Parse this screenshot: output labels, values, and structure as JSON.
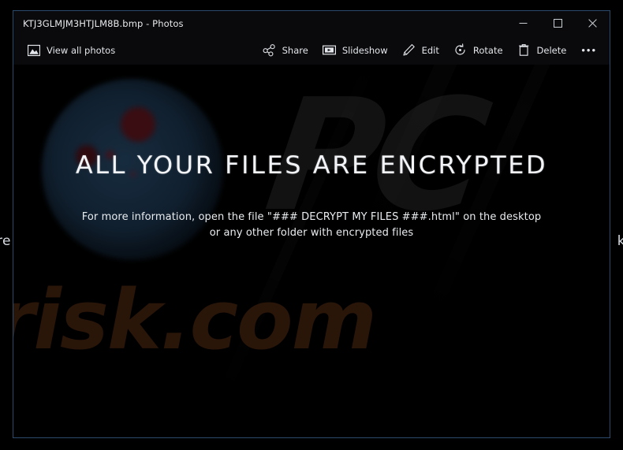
{
  "window": {
    "title": "KTJ3GLMJM3HTJLM8B.bmp - Photos",
    "controls": [
      {
        "name": "minimize",
        "label": "Minimize"
      },
      {
        "name": "maximize",
        "label": "Maximize"
      },
      {
        "name": "close",
        "label": "Close"
      }
    ]
  },
  "commandbar": {
    "view_all_photos": "View all photos",
    "view_all_photos_icon": "photo-icon",
    "share": "Share",
    "share_icon": "share-icon",
    "slideshow": "Slideshow",
    "slideshow_icon": "slideshow-icon",
    "edit": "Edit",
    "edit_icon": "pencil-icon",
    "rotate": "Rotate",
    "rotate_icon": "rotate-icon",
    "delete": "Delete",
    "delete_icon": "trash-icon",
    "more": "•••",
    "more_icon": "ellipsis-icon"
  },
  "image": {
    "heading": "ALL YOUR FILES ARE ENCRYPTED",
    "body_line_1": "For more information, open the file \"### DECRYPT MY FILES ###.html\" on the desktop",
    "body_line_2": "or any other folder with encrypted files",
    "watermark_logo": "PC",
    "watermark_domain": "risk.com"
  },
  "desktop": {
    "text_left_fragment": "re",
    "text_right_fragment": "k"
  },
  "colors": {
    "window_border": "#2c4a6b",
    "titlebar_bg": "#0a0a0c",
    "image_bg": "#000000",
    "note_text": "#f2f4f7",
    "watermark_domain_color": "#2a1509",
    "watermark_logo_color": "#121212",
    "glow_blue": "#182e42",
    "spot_red": "#3a0d12"
  }
}
